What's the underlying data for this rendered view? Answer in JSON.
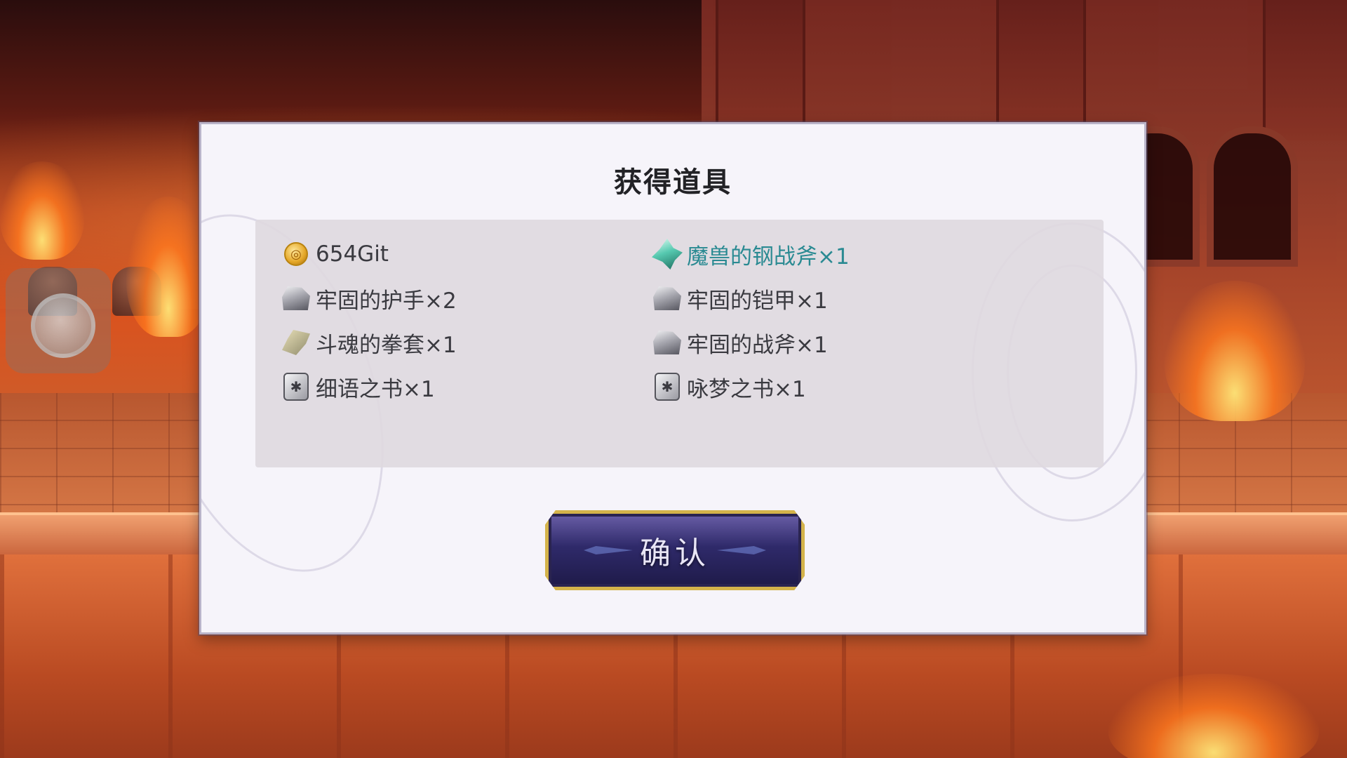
{
  "dialog": {
    "title": "获得道具",
    "confirm_label": "确认"
  },
  "rewards": [
    {
      "icon": "gold-coin-icon",
      "label": "654Git",
      "rarity": "normal"
    },
    {
      "icon": "crystal-icon",
      "label": "魔兽的钢战斧×1",
      "rarity": "rare"
    },
    {
      "icon": "ore-icon",
      "label": "牢固的护手×2",
      "rarity": "normal"
    },
    {
      "icon": "ore-icon",
      "label": "牢固的铠甲×1",
      "rarity": "normal"
    },
    {
      "icon": "gauntlet-icon",
      "label": "斗魂的拳套×1",
      "rarity": "normal"
    },
    {
      "icon": "ore-icon",
      "label": "牢固的战斧×1",
      "rarity": "normal"
    },
    {
      "icon": "book-icon",
      "label": "细语之书×1",
      "rarity": "normal"
    },
    {
      "icon": "book-icon",
      "label": "咏梦之书×1",
      "rarity": "normal"
    }
  ],
  "colors": {
    "rare_text": "#2a8a92",
    "normal_text": "#3a3a40",
    "button_border": "#d4b34a"
  }
}
